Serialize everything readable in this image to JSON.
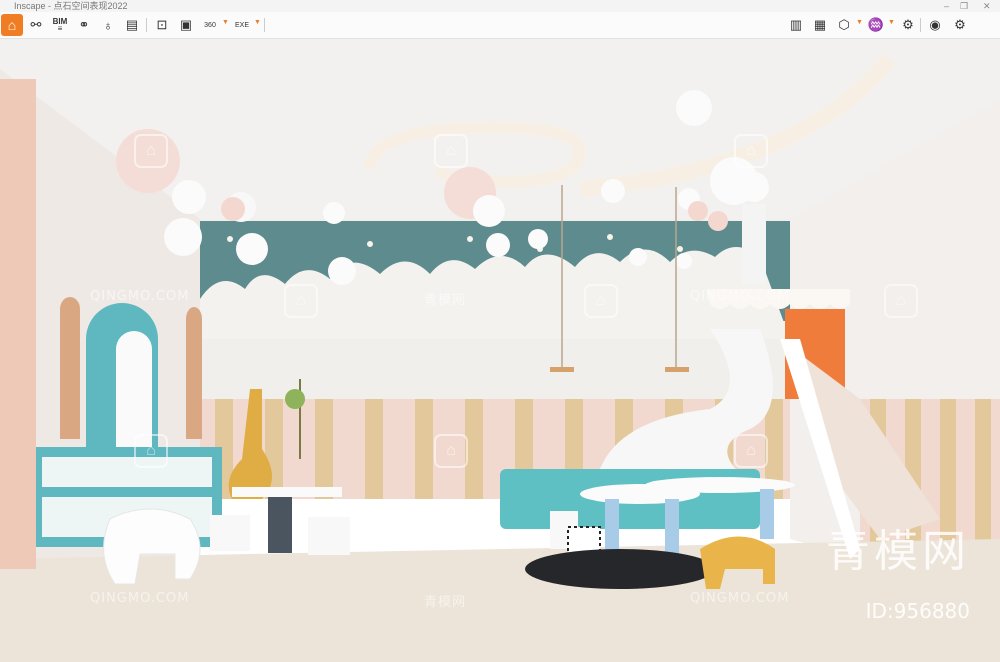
{
  "window": {
    "title": "Inscape - 点石空间表现2022",
    "minimize": "–",
    "maximize": "❐",
    "close": "✕"
  },
  "toolbar": {
    "left_icons": [
      "home-icon",
      "nodes-icon",
      "bim-icon",
      "binoculars-icon",
      "ice-cream-icon",
      "clapper-icon",
      "export-image-icon",
      "batch-render-icon",
      "render-360-icon",
      "exe-export-icon"
    ],
    "right_icons": [
      "map-icon",
      "presentation-icon",
      "cube-icon",
      "material-icon",
      "settings-panel-icon",
      "eye-icon",
      "gear-icon"
    ],
    "bim_label": "BIM",
    "render360_label": "360",
    "exe_label": "EXE"
  },
  "watermarks": {
    "latin": "QINGMO.COM",
    "chinese": "青模网",
    "brand": "青模网",
    "id_text": "ID:956880"
  },
  "colors": {
    "accent": "#f07c24",
    "teal": "#5fb8bf",
    "wall_teal": "#5e8c8e",
    "ceiling": "#f3f1ef",
    "floor": "#ece4d8"
  }
}
